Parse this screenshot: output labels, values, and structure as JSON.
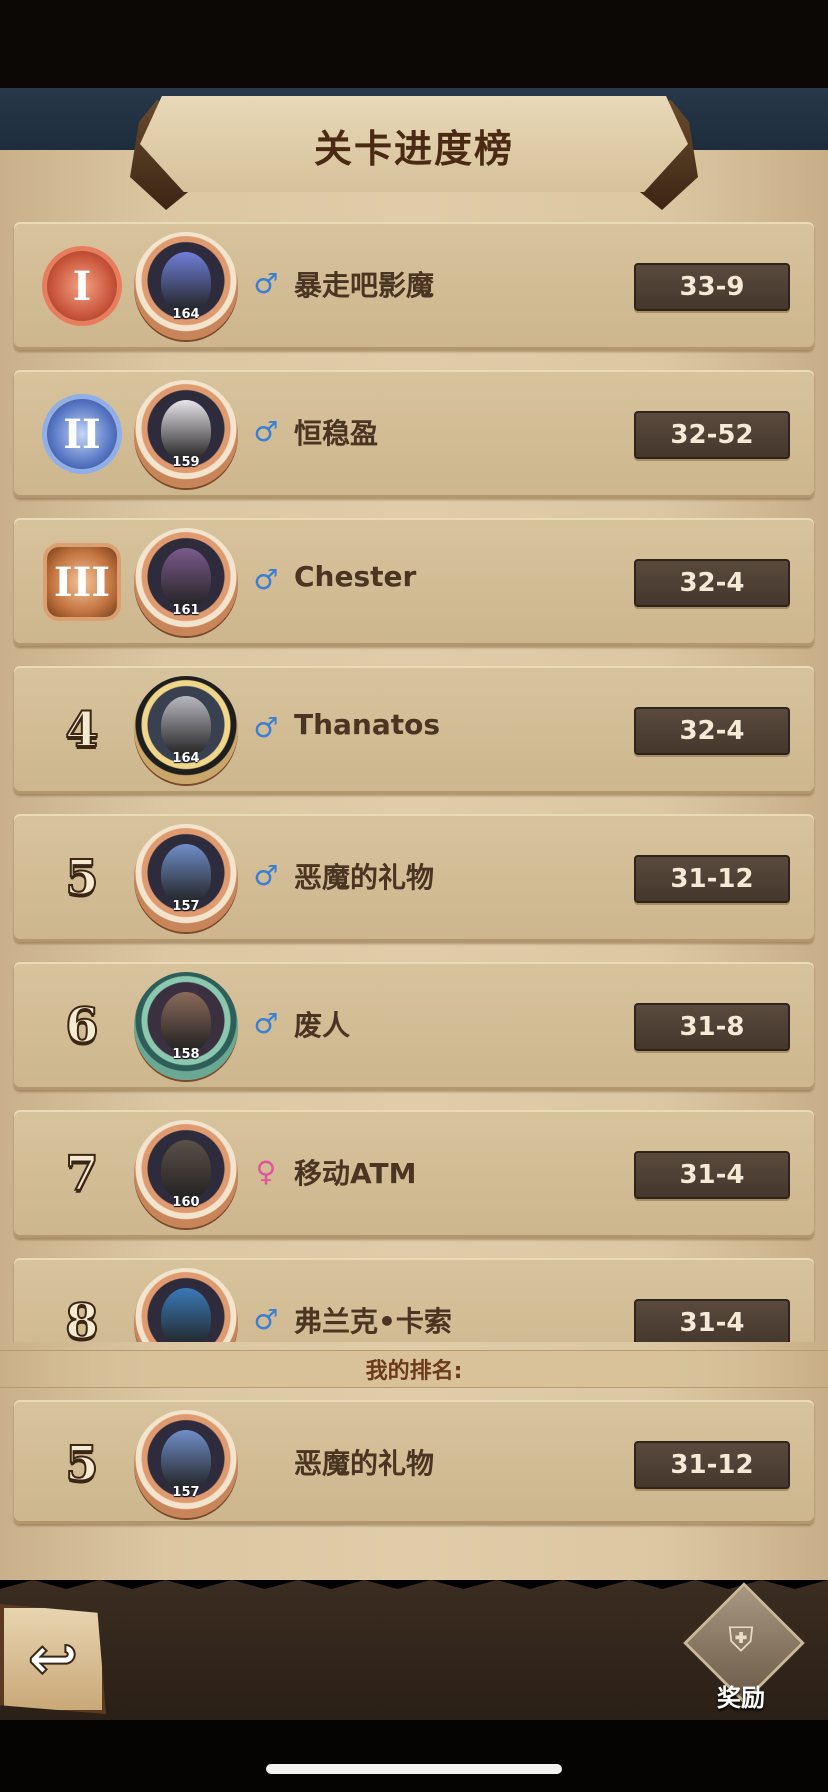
{
  "header": {
    "title": "关卡进度榜"
  },
  "leaderboard": [
    {
      "rank": "I",
      "rank_type": "medal-1",
      "level": "164",
      "gender": "♂",
      "gender_type": "male",
      "name": "暴走吧影魔",
      "score": "33-9",
      "face": "#6f7fd8",
      "frame": ""
    },
    {
      "rank": "II",
      "rank_type": "medal-2",
      "level": "159",
      "gender": "♂",
      "gender_type": "male",
      "name": "恒稳盈",
      "score": "32-52",
      "face": "#e8e4ea",
      "frame": ""
    },
    {
      "rank": "III",
      "rank_type": "medal-3",
      "level": "161",
      "gender": "♂",
      "gender_type": "male",
      "name": "Chester",
      "score": "32-4",
      "face": "#7b5a8c",
      "frame": ""
    },
    {
      "rank": "4",
      "rank_type": "number",
      "level": "164",
      "gender": "♂",
      "gender_type": "male",
      "name": "Thanatos",
      "score": "32-4",
      "face": "#b8b8c0",
      "frame": "gold"
    },
    {
      "rank": "5",
      "rank_type": "number",
      "level": "157",
      "gender": "♂",
      "gender_type": "male",
      "name": "恶魔的礼物",
      "score": "31-12",
      "face": "#6f8ec8",
      "frame": ""
    },
    {
      "rank": "6",
      "rank_type": "number",
      "level": "158",
      "gender": "♂",
      "gender_type": "male",
      "name": "废人",
      "score": "31-8",
      "face": "#8a6a5a",
      "frame": "jade"
    },
    {
      "rank": "7",
      "rank_type": "number",
      "level": "160",
      "gender": "♀",
      "gender_type": "female",
      "name": "移动ATM",
      "score": "31-4",
      "face": "#5a5048",
      "frame": ""
    },
    {
      "rank": "8",
      "rank_type": "number",
      "level": "",
      "gender": "♂",
      "gender_type": "male",
      "name": "弗兰克•卡索",
      "score": "31-4",
      "face": "#3a7ab8",
      "frame": ""
    }
  ],
  "my_rank": {
    "label": "我的排名:",
    "rank": "5",
    "level": "157",
    "name": "恶魔的礼物",
    "score": "31-12",
    "face": "#6f8ec8"
  },
  "footer": {
    "back_icon": "back-arrow-icon",
    "rewards_icon": "rewards-shield-icon",
    "rewards_label": "奖励"
  }
}
